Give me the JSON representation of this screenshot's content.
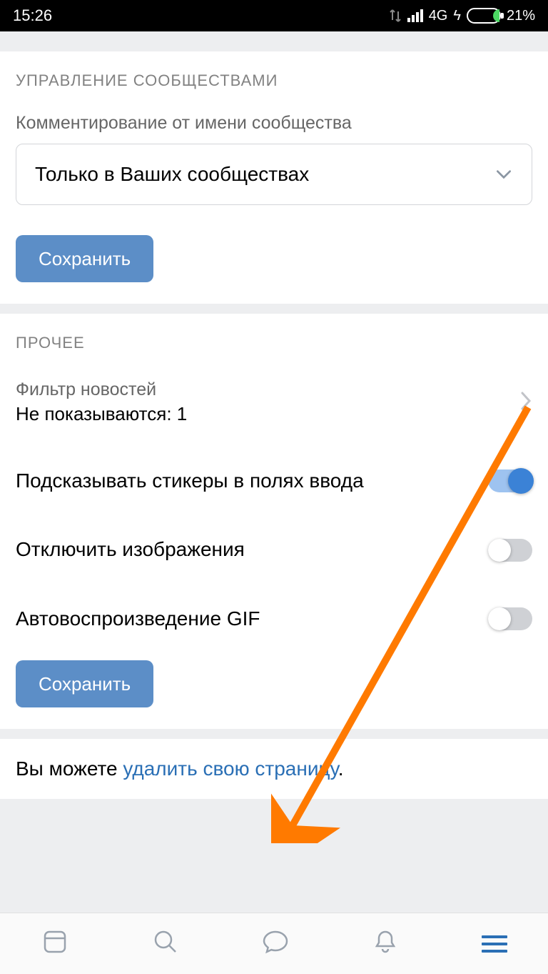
{
  "status": {
    "time": "15:26",
    "network": "4G",
    "battery": "21%"
  },
  "section1": {
    "header": "УПРАВЛЕНИЕ СООБЩЕСТВАМИ",
    "field_label": "Комментирование от имени сообщества",
    "select_value": "Только в Ваших сообществах",
    "save": "Сохранить"
  },
  "section2": {
    "header": "ПРОЧЕЕ",
    "filter_label": "Фильтр новостей",
    "filter_value": "Не показываются: 1",
    "stickers": "Подсказывать стикеры в полях ввода",
    "images": "Отключить изображения",
    "gif": "Автовоспроизведение GIF",
    "save": "Сохранить"
  },
  "delete": {
    "prefix": "Вы можете ",
    "link": "удалить свою страницу",
    "suffix": "."
  }
}
